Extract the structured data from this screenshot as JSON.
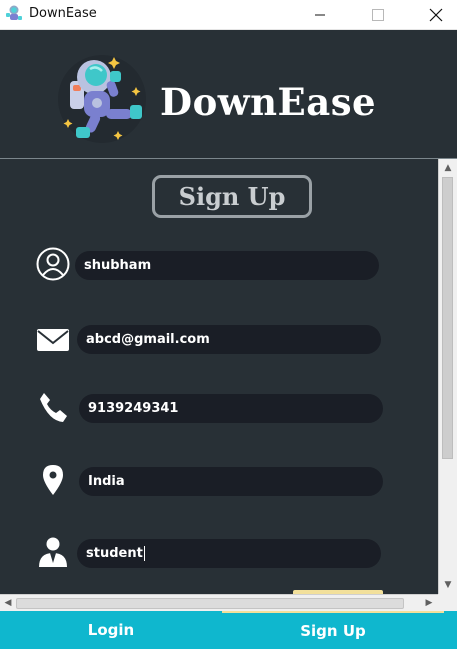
{
  "window": {
    "title": "DownEase"
  },
  "brand": {
    "name": "DownEase"
  },
  "form": {
    "heading": "Sign Up",
    "fields": [
      {
        "name": "username",
        "icon": "user-icon",
        "value": "shubham"
      },
      {
        "name": "email",
        "icon": "mail-icon",
        "value": "abcd@gmail.com"
      },
      {
        "name": "phone",
        "icon": "phone-icon",
        "value": "9139249341"
      },
      {
        "name": "location",
        "icon": "location-pin-icon",
        "value": "India"
      },
      {
        "name": "occupation",
        "icon": "person-suit-icon",
        "value": "student"
      }
    ]
  },
  "tabs": {
    "login": "Login",
    "signup": "Sign Up"
  },
  "colors": {
    "background": "#283036",
    "field": "#1a1e26",
    "accent": "#0fb7ce",
    "active_tab_indicator": "#f2e09b"
  }
}
